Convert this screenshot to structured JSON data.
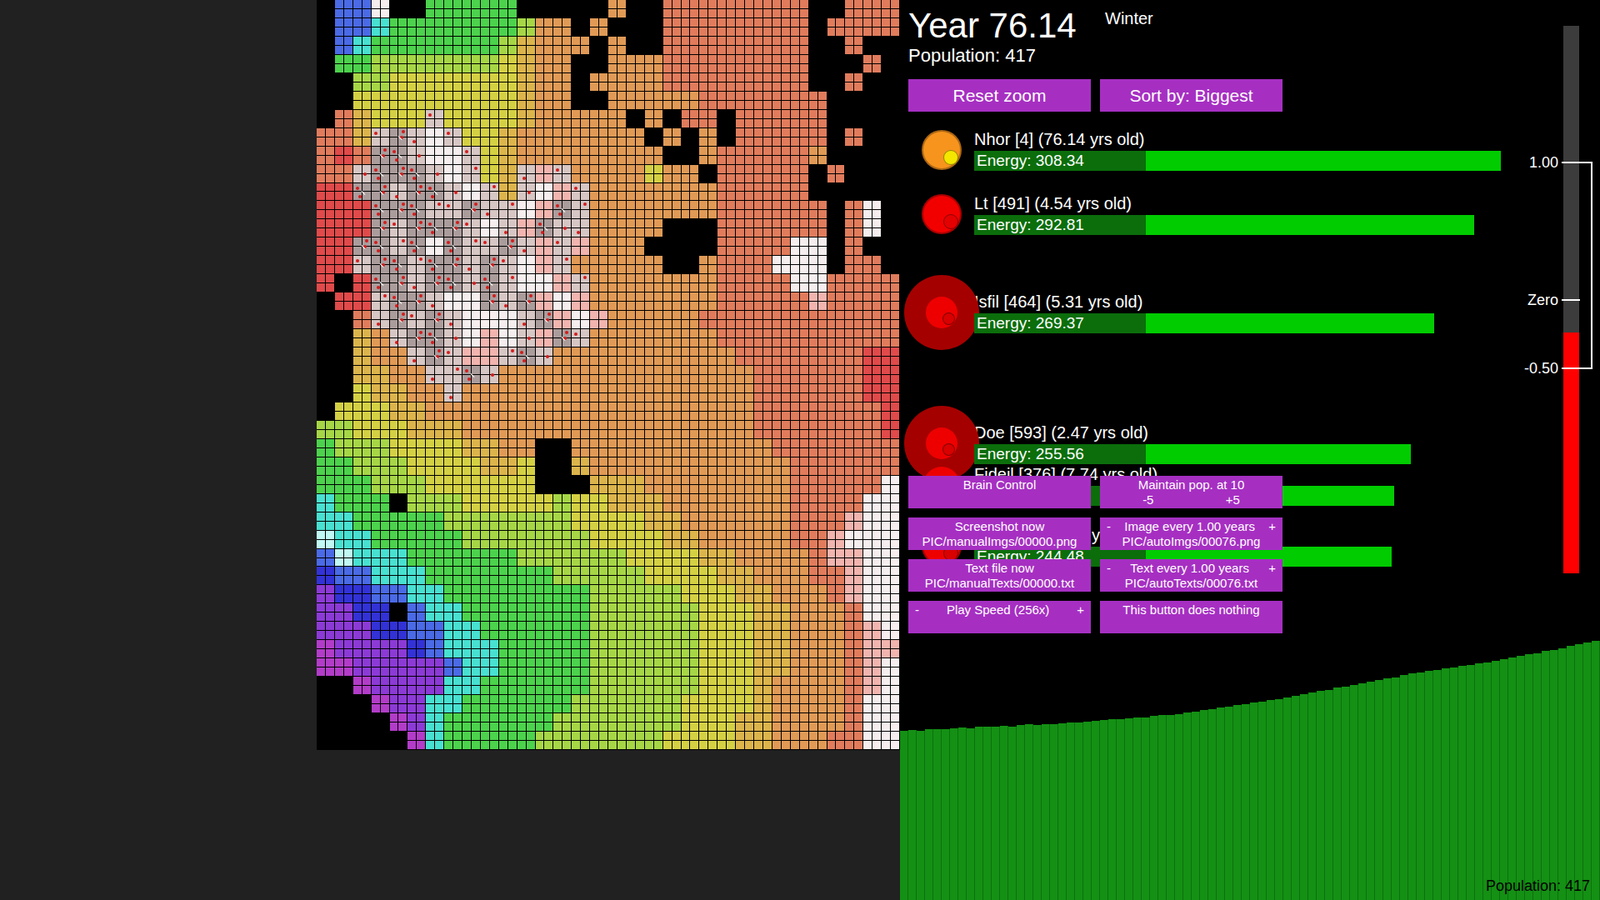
{
  "header": {
    "year": "Year 76.14",
    "season": "Winter",
    "population": "Population: 417"
  },
  "top_buttons": [
    "Reset zoom",
    "Sort by: Biggest"
  ],
  "creatures": [
    {
      "name": "Nhor [4] (76.14 yrs old)",
      "energy": "Energy: 308.34",
      "level": 0.9636,
      "kind": "small",
      "color": "#f7941d",
      "eye_color": "#f5e600",
      "covered": false
    },
    {
      "name": "Lt [491] (4.54 yrs old)",
      "energy": "Energy: 292.81",
      "level": 0.915,
      "kind": "small",
      "color": "#f20000",
      "eye_color": "#e40000",
      "covered": false
    },
    {
      "name": "Isfil [464] (5.31 yrs old)",
      "energy": "Energy: 269.37",
      "level": 0.8418,
      "kind": "large",
      "color": "#ee0000",
      "eye_color": "#d80000",
      "covered": false
    },
    {
      "name": "Doe [593] (2.47 yrs old)",
      "energy": "Energy: 255.56",
      "level": 0.7986,
      "kind": "large",
      "color": "#ee0000",
      "eye_color": "#d80000",
      "covered": false
    },
    {
      "name": "Fideil [376] (7.74 yrs old)",
      "level": 0.768,
      "kind": "small",
      "color": "#ee0000",
      "eye_color": "#d80000",
      "covered": false
    },
    {
      "name": "y",
      "energy": "Energy: 244.48",
      "level": 0.764,
      "kind": "small",
      "color": "#ee0000",
      "eye_color": "#d80000",
      "covered": true
    }
  ],
  "controls": [
    {
      "kind": "plain",
      "label": "Brain Control"
    },
    {
      "kind": "stepper",
      "label": "Maintain pop. at 10",
      "minus": "-5",
      "plus": "+5"
    },
    {
      "kind": "plain",
      "label": "Screenshot now",
      "sub": "PIC/manualImgs/00000.png"
    },
    {
      "kind": "ranged",
      "label": "Image every 1.00 years",
      "minus": "-",
      "plus": "+",
      "sub": "PIC/autoImgs/00076.png"
    },
    {
      "kind": "plain",
      "label": "Text file now",
      "sub": "PIC/manualTexts/00000.txt"
    },
    {
      "kind": "ranged",
      "label": "Text every 1.00 years",
      "minus": "-",
      "plus": "+",
      "sub": "PIC/autoTexts/00076.txt"
    },
    {
      "kind": "ranged",
      "label": "Play Speed (256x)",
      "minus": "-",
      "plus": "+"
    },
    {
      "kind": "plain",
      "label": "This button does nothing"
    }
  ],
  "meter": {
    "min": -2,
    "max": 2,
    "level": 0.44,
    "ticks": [
      {
        "label": "1.00",
        "value": 1,
        "kind": "bracket"
      },
      {
        "label": "Zero",
        "value": 0,
        "kind": "plain"
      },
      {
        "label": "-0.50",
        "value": -0.5,
        "kind": "bracket"
      }
    ]
  },
  "population_chart": {
    "label": "Population: 417",
    "values": [
      272,
      273,
      272,
      274,
      275,
      274,
      276,
      277,
      276,
      278,
      279,
      278,
      280,
      279,
      281,
      282,
      281,
      282,
      283,
      284,
      285,
      285,
      287,
      288,
      289,
      290,
      291,
      292,
      293,
      294,
      296,
      297,
      298,
      299,
      301,
      303,
      305,
      307,
      309,
      311,
      313,
      315,
      317,
      319,
      321,
      323,
      326,
      328,
      331,
      333,
      336,
      338,
      341,
      343,
      346,
      348,
      351,
      353,
      356,
      358,
      361,
      364,
      366,
      368,
      370,
      372,
      374,
      376,
      378,
      380,
      382,
      385,
      387,
      390,
      392,
      395,
      397,
      400,
      402,
      405,
      408,
      411,
      414,
      417
    ]
  },
  "map": {
    "legend": {
      ".": "#000000",
      "b": "#4a6ae6",
      "B": "#3232d6",
      "P": "#8c3ad6",
      "M": "#b23cc8",
      "C": "#48e0d0",
      "c": "#c0f8f4",
      "g": "#4cd24c",
      "G": "#a6d646",
      "y": "#d4d044",
      "Y": "#dcb44c",
      "O": "#e09a56",
      "S": "#e07c5c",
      "R": "#e04a4a",
      "p": "#f2b4ae",
      "W": "#f6eeee",
      "k": "#ab9c9c",
      "q": "#d6c6c4"
    },
    "rows": [
      ".bbW..ggggg.....O..SSSSSSSS..SSS",
      ".bbCgggggggGOO.O...SSSSSSSS.SSSS",
      ".bCgggggggGYOOO.O..SSSSSSSS..S..",
      ".ggGGGGGGGyYOO..OOOSSSSSSSS...S.",
      "..GGyyyyyyyYOO.OOOOSSSSSSSS..S..",
      "..yyyyyyyyyYOO..OOOOOSSSSSSS....",
      ".SYyyyqyyyyYOOOOO.O.SS.SSSSS....",
      "SSYqkqWqyyYOOOOOOO.O.O.SSSSS.S..",
      "SRSkkqWWqyYOOOOOOOO..OSSSSSO....",
      "SSqkkkqWqyYqpqOOOOyOO.SSSSS.S...",
      "RRkkqkkqWqYqWpqOOOOOOOSSSSS.....",
      "RRRkkkqqkqqWpkqOOOOOOOSSSSSS.SW.",
      "RRRkqkkkqWqpkqqOOOO...SSSSSS.SW.",
      "RRkkqkWkqqkqpqpOOO....SSSSWW.S..",
      "RRqkkqkkqkqWpqOOOOO..OSSSWWW.SS.",
      "R.RkkqkkqkqWWpqOOOOOOOSSSSWWSSSS",
      ".RRqkkqWWkqkpWpOOOOOOOSSSSSpSSSS",
      "..SqkqkqWWWqkpWpOOOOOSSSSSSSSSSS",
      "..YOqkkqWpWqpkqOOOOOOOSSSSSSSSSS",
      "..YOOqkqppqkqOOOOOOOOOOSSSSSSSRR",
      "..YYOOqqkqOOOOOOOOOOOOOOSSSSSSRR",
      "..yYYOOqOOOOOOOOOOOOOOOOSSSSSSRR",
      ".yyyYYOOOOOOOOOOOOOOOOOOSSSSSSSR",
      "GGyyyYYYOOOOOOOOOOOOOOOOSSSSSSSR",
      "gGGGyyyyYYOO..OOOOOOOOOOOSSSSSSS",
      "ggGGGyyyyYYy..YOOOOOOOOOOOSSSSSS",
      "gggGGGyyyyyy...YYYOOOOOOOOSSSSSW",
      "Cggg.GGGyyyyyGyyYYYOOOOOOOSSSSWW",
      "CCgggggGGGGGGGyyyyYYOOOOOOSSSpWW",
      "cCCgggggGGGGGGGyyyyYYOOOOOSSpWWW",
      "bcCCCggggggGGGGGGyyyyYYOOOOSppWW",
      "BbbCCCgggggggGGGGGyyyyYYOOOSSpWW",
      "PBBbbCCggggggggGGGGGyyyYYOOOSpWW",
      "PPBB.bCCgggggggGGGGGGyyyYYOOOSWW",
      "PPPBBbbCCggggggGGGGGGyyyYYOOOSpW",
      "MPPPPBbCCCgggggGGGGGGyyyYYOOOSpp",
      "MMPPPPPbCCgggggGGGGGGyyyYYOOOSpW",
      "..MPPPPCCggggggGGGGGGyyyYOOOOSpW",
      "...MPPCCggggggGGGGGGyyyyYOOOOSWW",
      "....MPCggggggGGGGGGGyyyYYOOOOSWW",
      ".....MCgggggGGGGGGGyyyyYYOOOSSWW"
    ]
  }
}
